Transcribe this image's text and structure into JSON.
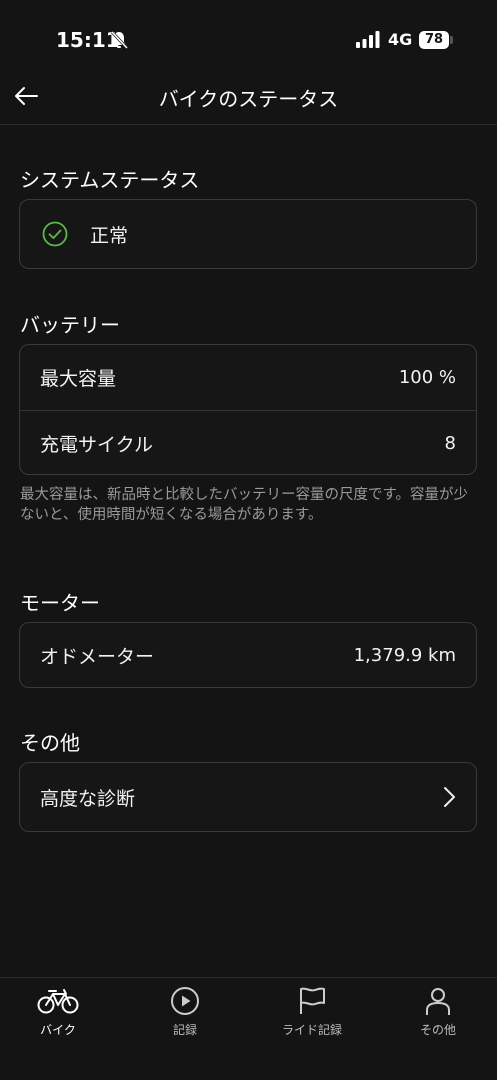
{
  "status_bar": {
    "time": "15:11",
    "network": "4G",
    "battery": "78"
  },
  "header": {
    "title": "バイクのステータス"
  },
  "system_status": {
    "title": "システムステータス",
    "value": "正常"
  },
  "battery": {
    "title": "バッテリー",
    "rows": [
      {
        "label": "最大容量",
        "value": "100 %"
      },
      {
        "label": "充電サイクル",
        "value": "8"
      }
    ],
    "note": "最大容量は、新品時と比較したバッテリー容量の尺度です。容量が少ないと、使用時間が短くなる場合があります。"
  },
  "motor": {
    "title": "モーター",
    "rows": [
      {
        "label": "オドメーター",
        "value": "1,379.9 km"
      }
    ]
  },
  "other": {
    "title": "その他",
    "rows": [
      {
        "label": "高度な診断"
      }
    ]
  },
  "nav": {
    "items": [
      {
        "label": "バイク"
      },
      {
        "label": "記録"
      },
      {
        "label": "ライド記録"
      },
      {
        "label": "その他"
      }
    ]
  },
  "colors": {
    "accent_green": "#5ab84a",
    "background": "#141414"
  }
}
